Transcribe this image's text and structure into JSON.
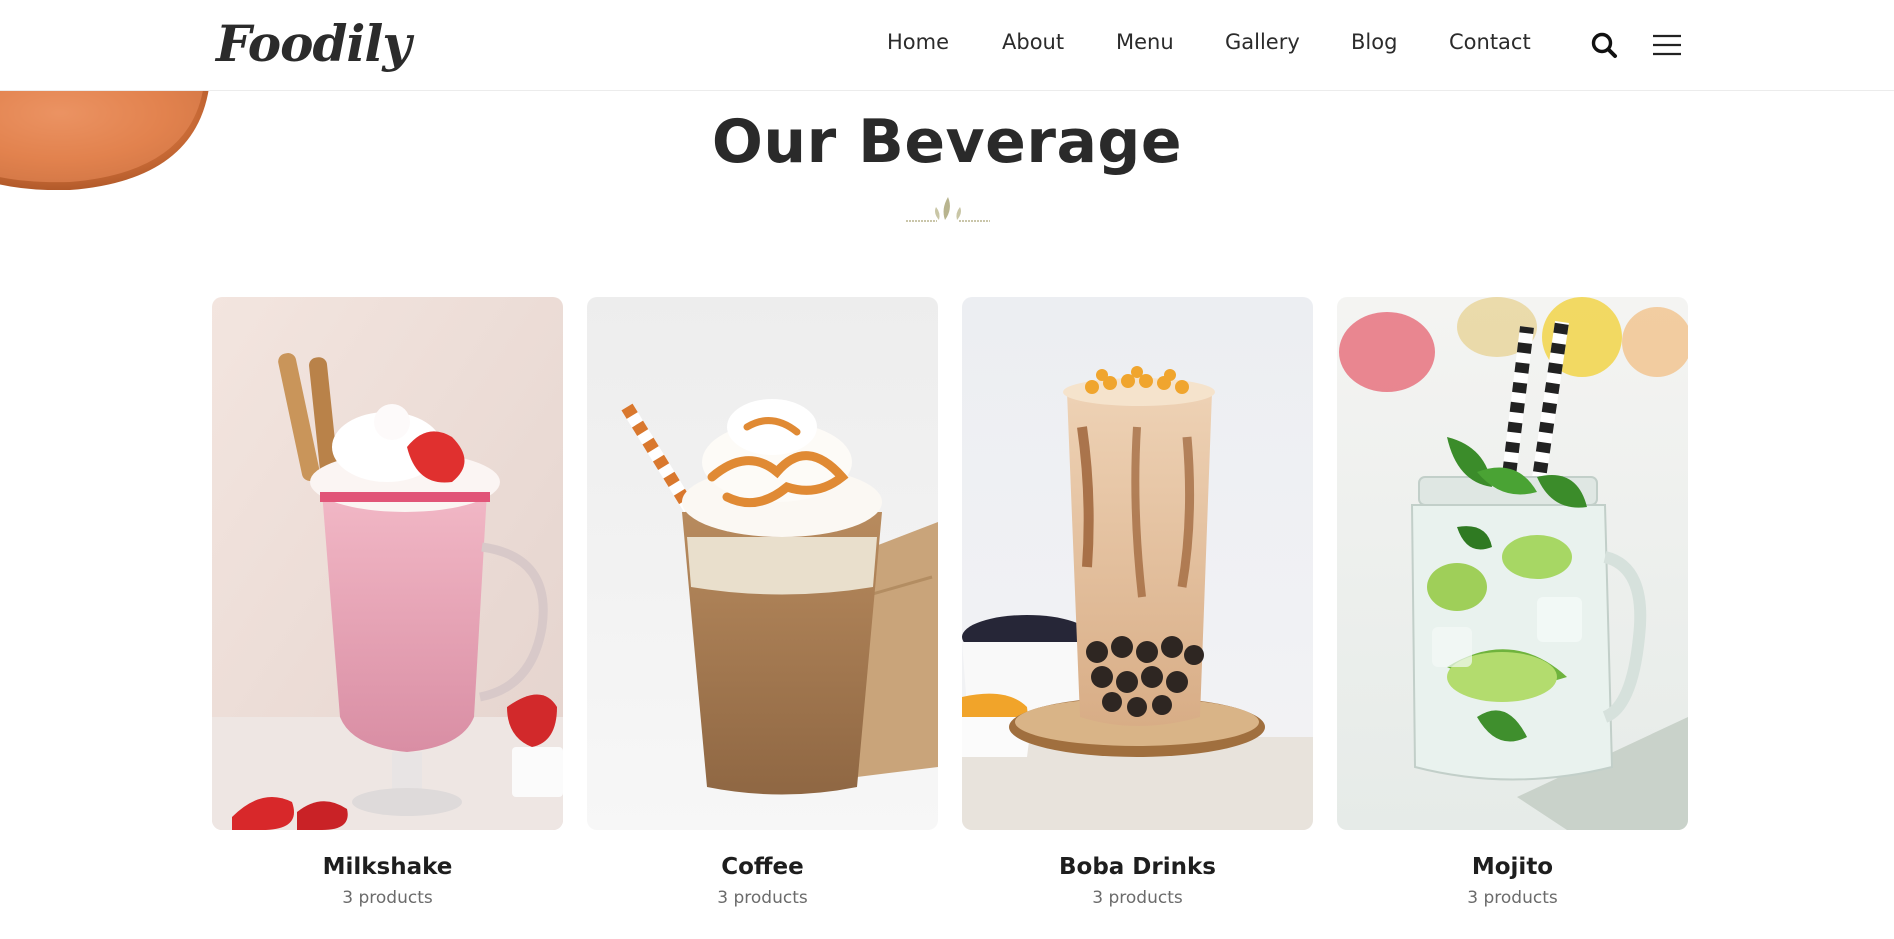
{
  "header": {
    "logo_text": "Foodily",
    "nav": [
      {
        "label": "Home"
      },
      {
        "label": "About"
      },
      {
        "label": "Menu"
      },
      {
        "label": "Gallery"
      },
      {
        "label": "Blog"
      },
      {
        "label": "Contact"
      }
    ],
    "search_icon": "search-icon",
    "menu_icon": "hamburger-menu-icon"
  },
  "section": {
    "title": "Our Beverage",
    "divider_icon": "leaf-divider-icon"
  },
  "cards": [
    {
      "title": "Milkshake",
      "count": "3 products",
      "image": "strawberry-milkshake"
    },
    {
      "title": "Coffee",
      "count": "3 products",
      "image": "iced-coffee"
    },
    {
      "title": "Boba Drinks",
      "count": "3 products",
      "image": "boba-milk-tea"
    },
    {
      "title": "Mojito",
      "count": "3 products",
      "image": "mojito-jar"
    }
  ],
  "colors": {
    "text_dark": "#2a2a2a",
    "text_muted": "#6b6b6b",
    "accent_leaf": "#b8b48e"
  }
}
